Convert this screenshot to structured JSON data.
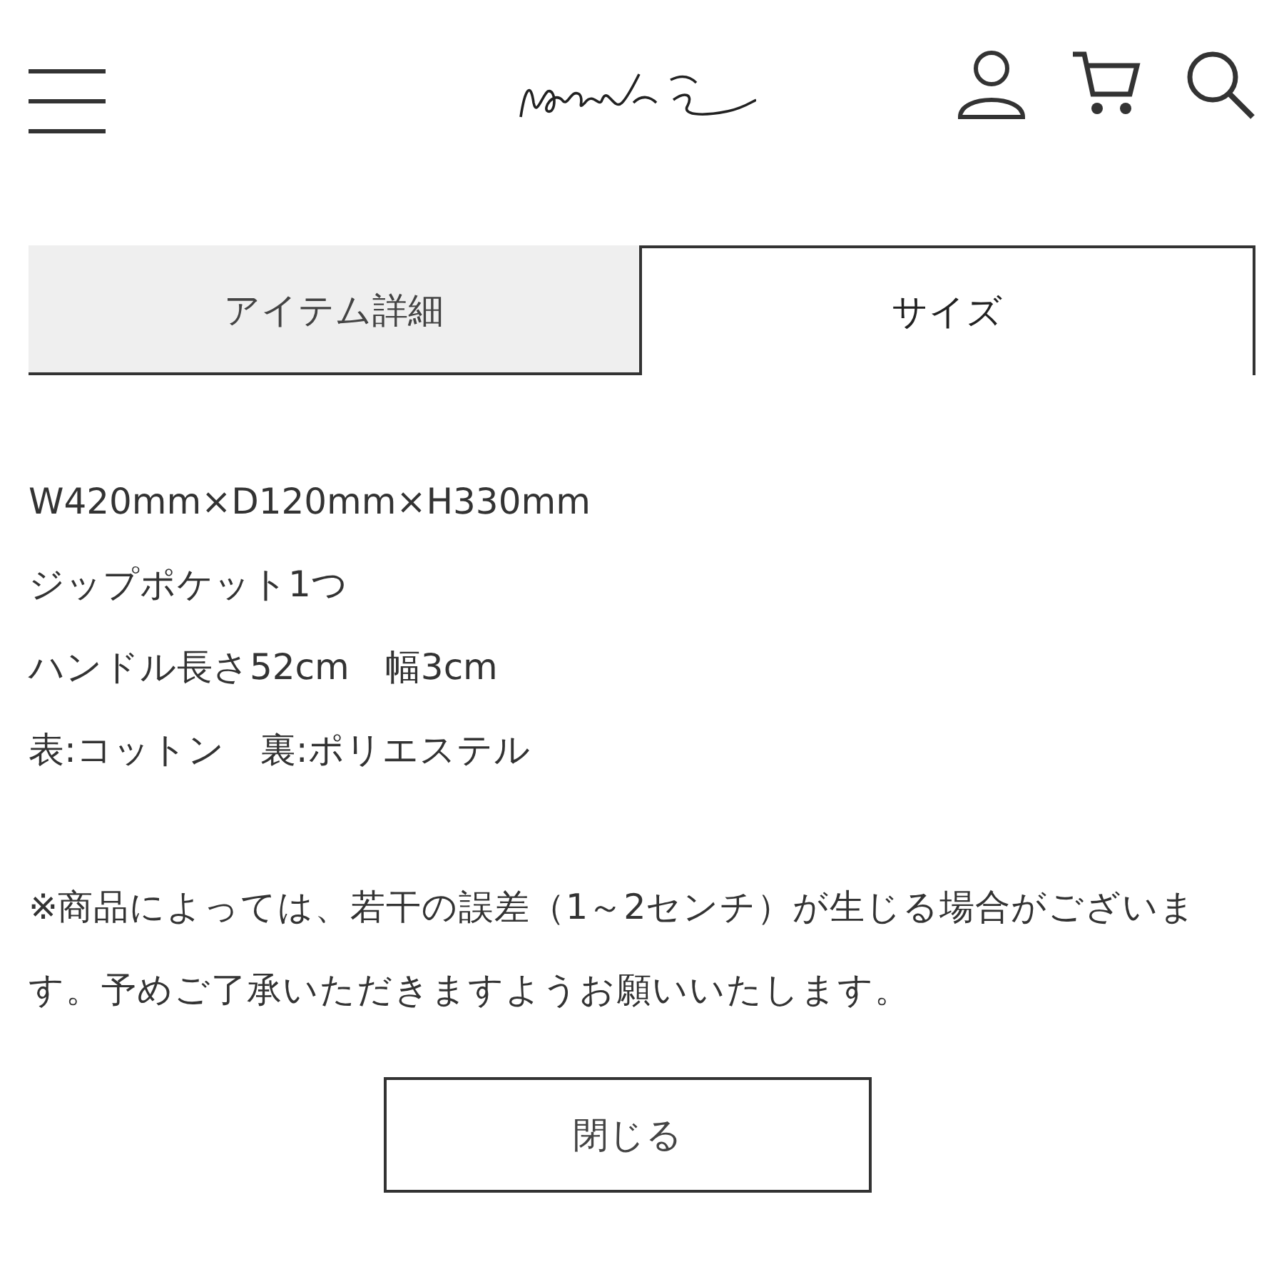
{
  "tabs": [
    {
      "label": "アイテム詳細",
      "selected": false
    },
    {
      "label": "サイズ",
      "selected": true
    }
  ],
  "size_lines": [
    "W420mm×D120mm×H330mm",
    "ジップポケット1つ",
    "ハンドル長さ52cm　幅3cm",
    "表:コットン　裏:ポリエステル"
  ],
  "note": "※商品によっては、若干の誤差（1～2センチ）が生じる場合がございます。予めご了承いただきますようお願いいたします。",
  "close_button": "閉じる"
}
